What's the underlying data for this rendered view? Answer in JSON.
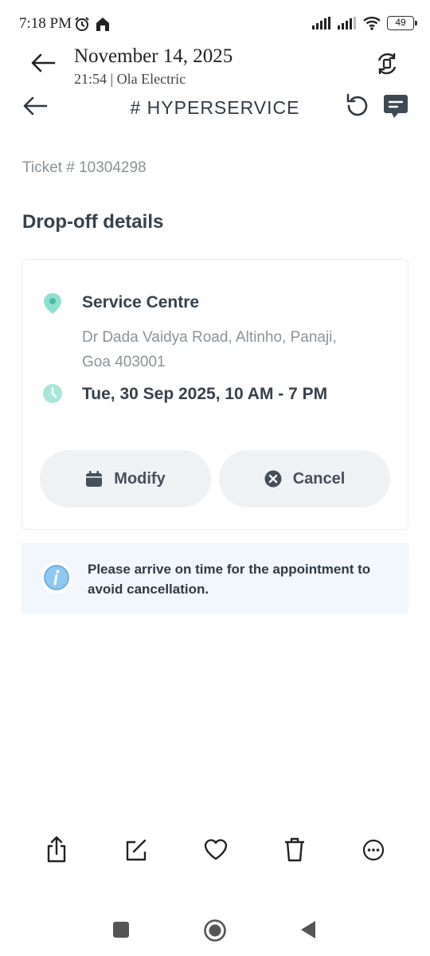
{
  "status_bar": {
    "time": "7:18 PM",
    "battery": "49"
  },
  "gallery_header": {
    "date": "November 14, 2025",
    "subtitle": "21:54 | Ola Electric"
  },
  "app_header": {
    "title": "# HYPERSERVICE"
  },
  "ticket": {
    "label": "Ticket # 10304298"
  },
  "section": {
    "title": "Drop-off details"
  },
  "card": {
    "centre_name": "Service Centre",
    "address": "Dr Dada Vaidya Road, Altinho, Panaji, Goa 403001",
    "slot": "Tue, 30 Sep 2025, 10 AM - 7 PM",
    "modify_label": "Modify",
    "cancel_label": "Cancel"
  },
  "notice": {
    "text": "Please arrive on time for the appointment to avoid cancellation."
  },
  "colors": {
    "accent_teal": "#7fd6c4",
    "info_blue": "#7bbcec",
    "pill_bg": "#eef2f5",
    "notice_bg": "#f1f7fc"
  }
}
